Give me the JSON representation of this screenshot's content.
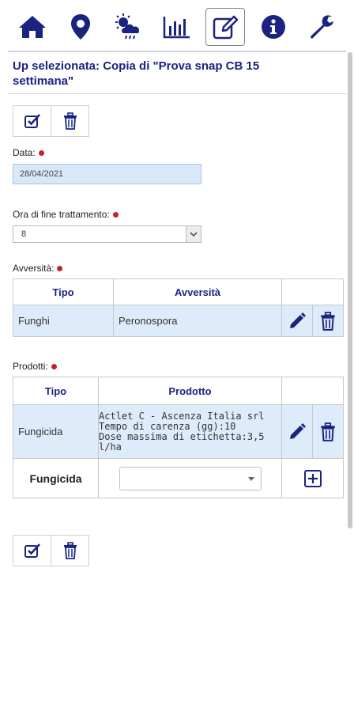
{
  "nav": {
    "items": [
      {
        "icon": "home-icon"
      },
      {
        "icon": "map-marker-icon"
      },
      {
        "icon": "weather-icon"
      },
      {
        "icon": "bar-chart-icon"
      },
      {
        "icon": "edit-icon",
        "active": true
      },
      {
        "icon": "info-icon"
      },
      {
        "icon": "wrench-icon"
      }
    ],
    "icon_color": "#1a2480"
  },
  "header": {
    "title": "Up selezionata: Copia di \"Prova snap CB 15 settimana\""
  },
  "actions": {
    "confirm_icon": "checkbox-check-icon",
    "delete_icon": "trash-icon"
  },
  "form": {
    "data_label": "Data:",
    "data_value": "28/04/2021",
    "ora_label": "Ora di fine trattamento:",
    "ora_value": "8",
    "avversita_label": "Avversità:",
    "prodotti_label": "Prodotti:"
  },
  "avversita_table": {
    "headers": [
      "Tipo",
      "Avversità",
      ""
    ],
    "rows": [
      {
        "tipo": "Funghi",
        "avversita": "Peronospora"
      }
    ]
  },
  "prodotti_table": {
    "headers": [
      "Tipo",
      "Prodotto",
      ""
    ],
    "rows": [
      {
        "tipo": "Fungicida",
        "line1": "Actlet C - Ascenza Italia srl",
        "line2": "Tempo di carenza (gg):10",
        "line3": "Dose massima di etichetta:3,5",
        "line4": "l/ha"
      }
    ],
    "new_row": {
      "tipo": "Fungicida",
      "selected": ""
    }
  },
  "colors": {
    "accent": "#1a2480",
    "required_dot": "#cc1f1f",
    "selected_row": "#deebfa"
  }
}
